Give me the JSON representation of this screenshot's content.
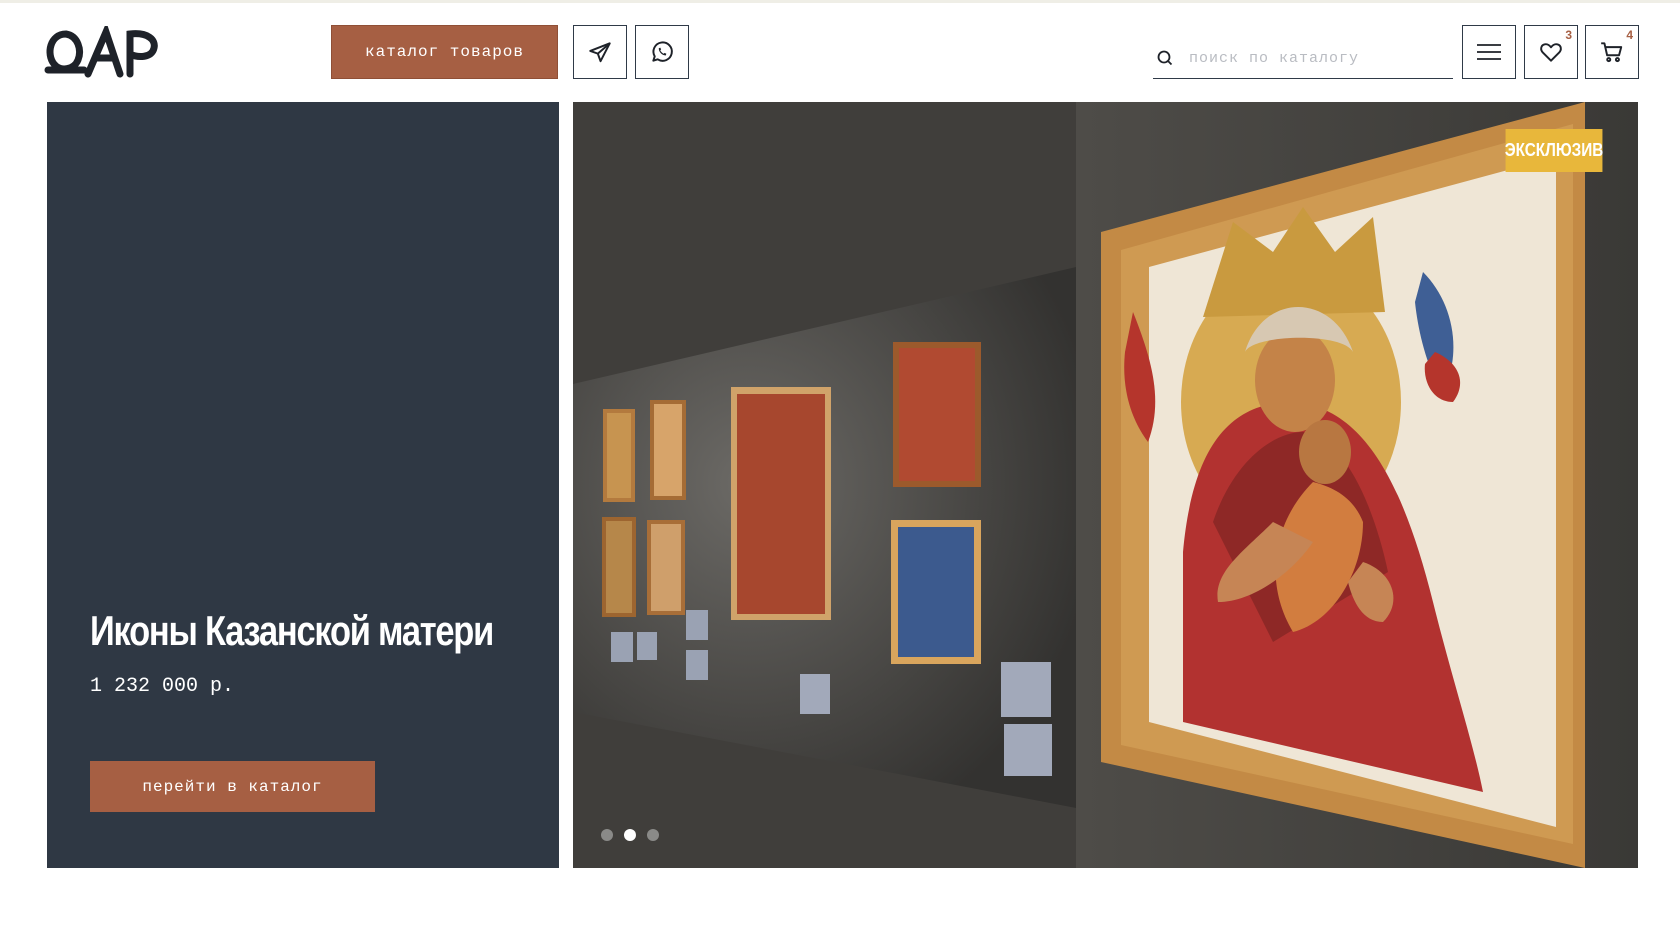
{
  "header": {
    "logo_alt": "ДАР",
    "catalog_button": "каталог товаров",
    "search_placeholder": "поиск по каталогу",
    "favorites_count": "3",
    "cart_count": "4"
  },
  "promo": {
    "title": "Иконы Казанской матери",
    "price": "1 232 000 р.",
    "button": "перейти в каталог"
  },
  "slider": {
    "badge": "ЭКСКЛЮЗИВ",
    "slide_count": 3,
    "active_slide": 2
  },
  "colors": {
    "accent": "#a65f43",
    "panel": "#2f3844",
    "badge": "#e8b73b"
  }
}
